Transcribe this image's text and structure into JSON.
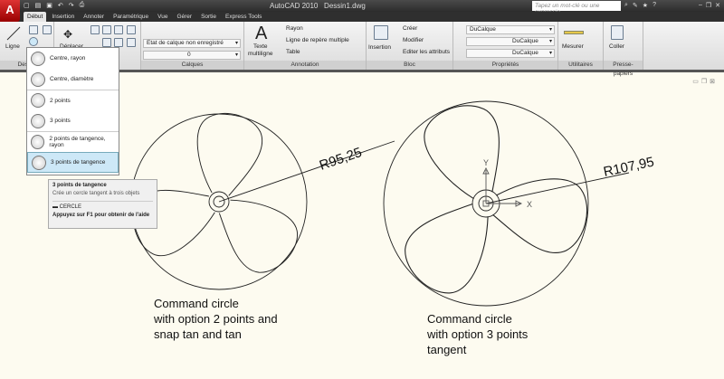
{
  "app": {
    "logo": "A",
    "title": "AutoCAD 2010",
    "document": "Dessin1.dwg",
    "search_placeholder": "Tapez un mot-clé ou une expressio"
  },
  "qat": [
    "new-icon",
    "open-icon",
    "save-icon",
    "undo-icon",
    "redo-icon",
    "plot-icon"
  ],
  "tabs": [
    "Début",
    "Insertion",
    "Annoter",
    "Paramétrique",
    "Vue",
    "Gérer",
    "Sortie",
    "Express Tools"
  ],
  "panels": {
    "dessin": {
      "label": "Dessin",
      "ligne": "Ligne"
    },
    "modifier": {
      "deplacer": "Déplacer"
    },
    "calques": {
      "label": "Calques",
      "state": "Etat de calque non enregistré",
      "layer": "0"
    },
    "annotation": {
      "label": "Annotation",
      "texte": "Texte",
      "multiligne": "multiligne",
      "rayon": "Rayon",
      "ligne_repere": "Ligne de repère multiple",
      "table": "Table",
      "big_letter": "A"
    },
    "bloc": {
      "label": "Bloc",
      "insertion": "Insertion",
      "creer": "Créer",
      "modifier": "Modifier",
      "editer": "Editer les attributs"
    },
    "proprietes": {
      "label": "Propriétés",
      "color": "DuCalque",
      "linetype": "DuCalque",
      "lineweight": "DuCalque"
    },
    "utilitaires": {
      "label": "Utilitaires",
      "mesurer": "Mesurer"
    },
    "presse": {
      "label": "Presse-papiers",
      "coller": "Coller"
    }
  },
  "circle_menu": [
    "Centre, rayon",
    "Centre, diamètre",
    "2 points",
    "3 points",
    "2 points de tangence, rayon",
    "3 points de tangence"
  ],
  "tooltip": {
    "title": "3 points de tangence",
    "desc": "Crée un cercle tangent à trois objets",
    "command": "CERCLE",
    "help": "Appuyez sur F1 pour obtenir de l'aide"
  },
  "drawing": {
    "left": {
      "dimension": "R95,25",
      "caption": [
        "Command circle",
        "with option 2 points and",
        "snap tan and tan"
      ]
    },
    "right": {
      "dimension": "R107,95",
      "caption": [
        "Command circle",
        "with option 3 points",
        "tangent"
      ]
    },
    "ucs": {
      "x": "X",
      "y": "Y"
    }
  },
  "colors": {
    "background": "#fdfbf0",
    "accent": "#cde8f7"
  }
}
